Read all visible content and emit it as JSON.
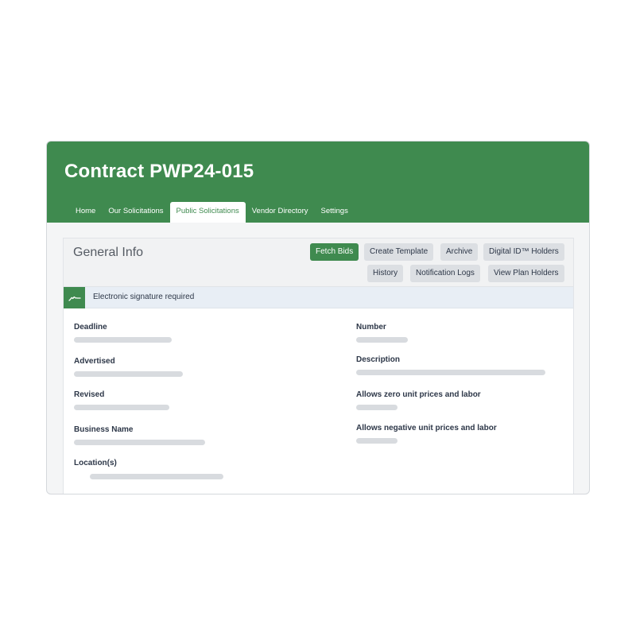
{
  "app": {
    "title": "Contract PWP24-015"
  },
  "tabs": [
    {
      "label": "Home"
    },
    {
      "label": "Our Solicitations"
    },
    {
      "label": "Public Solicitations",
      "active": true
    },
    {
      "label": "Vendor Directory"
    },
    {
      "label": "Settings"
    }
  ],
  "panel": {
    "title": "General Info",
    "buttons": {
      "fetch_bids": "Fetch Bids",
      "create_template": "Create Template",
      "archive": "Archive",
      "digital_id_holders": "Digital ID™ Holders",
      "history": "History",
      "notification_logs": "Notification Logs",
      "view_plan_holders": "View Plan Holders"
    },
    "notice": {
      "icon": "signature-icon",
      "text": "Electronic signature required"
    }
  },
  "fields": {
    "left": [
      {
        "label": "Deadline"
      },
      {
        "label": "Advertised"
      },
      {
        "label": "Revised"
      },
      {
        "label": "Business Name"
      },
      {
        "label": "Location(s)"
      }
    ],
    "right": [
      {
        "label": "Number"
      },
      {
        "label": "Description"
      },
      {
        "label": "Allows zero unit prices and labor"
      },
      {
        "label": "Allows negative unit prices and labor"
      }
    ]
  },
  "colors": {
    "brand_green": "#3f8a4f",
    "button_gray": "#dcdfe3",
    "notice_bg": "#e8eef5",
    "placeholder": "#d8dbdf"
  }
}
